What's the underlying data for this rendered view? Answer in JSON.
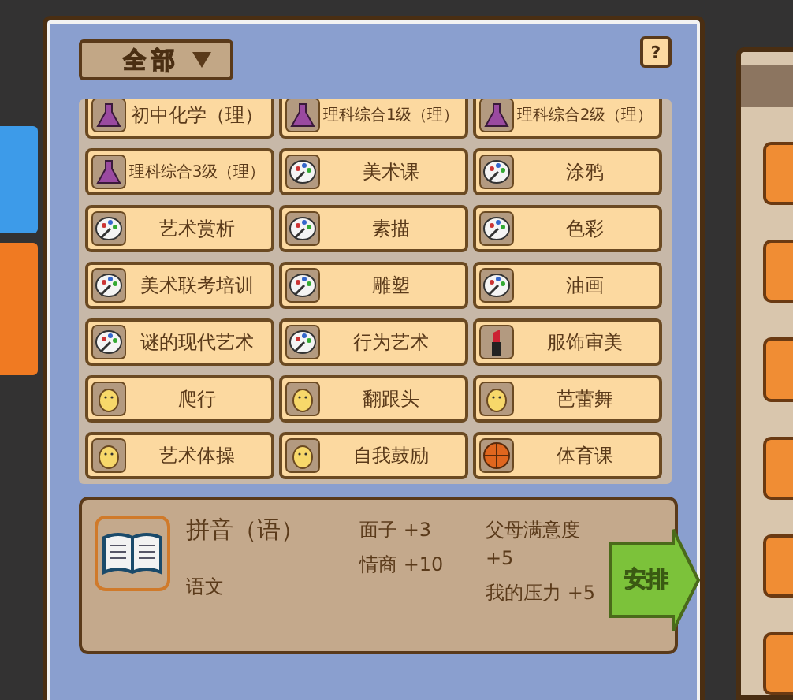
{
  "filter": {
    "label": "全部"
  },
  "help": {
    "label": "?"
  },
  "courses": [
    {
      "name": "初中化学（理）",
      "kind": "flask"
    },
    {
      "name": "理科综合1级（理）",
      "kind": "flask"
    },
    {
      "name": "理科综合2级（理）",
      "kind": "flask"
    },
    {
      "name": "理科综合3级（理）",
      "kind": "flask"
    },
    {
      "name": "美术课",
      "kind": "palette"
    },
    {
      "name": "涂鸦",
      "kind": "palette"
    },
    {
      "name": "艺术赏析",
      "kind": "palette"
    },
    {
      "name": "素描",
      "kind": "palette"
    },
    {
      "name": "色彩",
      "kind": "palette"
    },
    {
      "name": "美术联考培训",
      "kind": "palette"
    },
    {
      "name": "雕塑",
      "kind": "palette"
    },
    {
      "name": "油画",
      "kind": "palette"
    },
    {
      "name": "谜的现代艺术",
      "kind": "palette"
    },
    {
      "name": "行为艺术",
      "kind": "palette"
    },
    {
      "name": "服饰审美",
      "kind": "lipstick"
    },
    {
      "name": "爬行",
      "kind": "chick"
    },
    {
      "name": "翻跟头",
      "kind": "chick"
    },
    {
      "name": "芭蕾舞",
      "kind": "chick"
    },
    {
      "name": "艺术体操",
      "kind": "chick"
    },
    {
      "name": "自我鼓励",
      "kind": "chick"
    },
    {
      "name": "体育课",
      "kind": "ball"
    }
  ],
  "detail": {
    "kind": "book",
    "title": "拼音（语）",
    "subject": "语文",
    "effects": [
      "面子 +3",
      "情商 +10"
    ],
    "effects_2": [
      "父母满意度 +5",
      "我的压力 +5"
    ],
    "action": "安排"
  }
}
